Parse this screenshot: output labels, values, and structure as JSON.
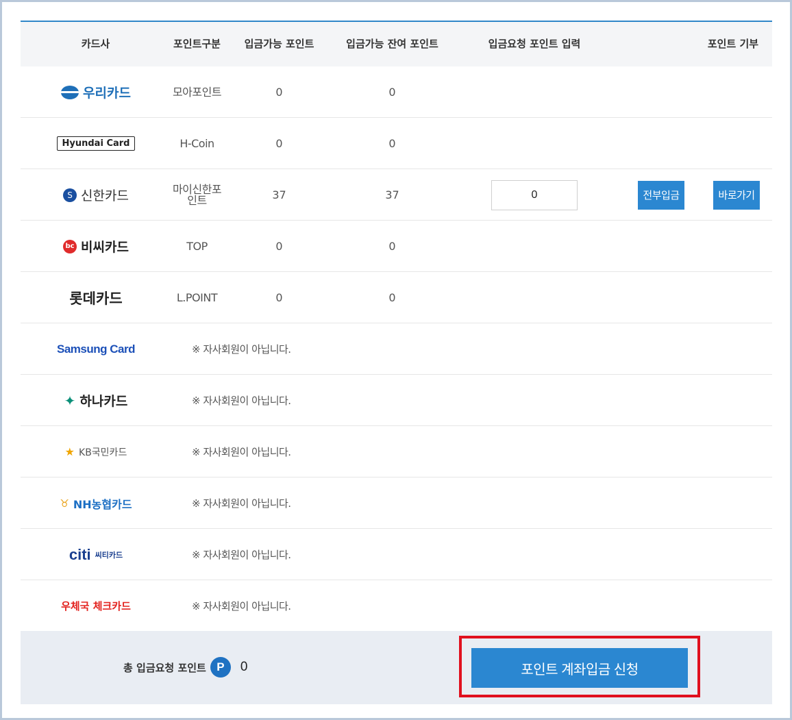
{
  "header": {
    "company": "카드사",
    "point_type": "포인트구분",
    "available": "입금가능 포인트",
    "remaining": "입금가능 잔여 포인트",
    "request_input": "입금요청 포인트 입력",
    "donate": "포인트 기부"
  },
  "rows": [
    {
      "logo": "우리카드",
      "logo_icon": "woori-logo",
      "type": "모아포인트",
      "available": "0",
      "remaining": "0"
    },
    {
      "logo": "Hyundai Card",
      "logo_icon": "hyundai-logo",
      "type": "H-Coin",
      "available": "0",
      "remaining": "0"
    },
    {
      "logo": "신한카드",
      "logo_icon": "shinhan-logo",
      "type_line1": "마이신한포",
      "type_line2": "인트",
      "available": "37",
      "remaining": "37",
      "input_value": "0",
      "all_button": "전부입금",
      "go_button": "바로가기"
    },
    {
      "logo": "비씨카드",
      "logo_icon": "bc-logo",
      "type": "TOP",
      "available": "0",
      "remaining": "0"
    },
    {
      "logo": "롯데카드",
      "logo_icon": "lotte-logo",
      "type": "L.POINT",
      "available": "0",
      "remaining": "0"
    },
    {
      "logo": "Samsung Card",
      "logo_icon": "samsung-logo",
      "note": "※ 자사회원이 아닙니다."
    },
    {
      "logo": "하나카드",
      "logo_icon": "hana-logo",
      "note": "※ 자사회원이 아닙니다."
    },
    {
      "logo": "KB국민카드",
      "logo_icon": "kb-logo",
      "note": "※ 자사회원이 아닙니다."
    },
    {
      "logo": "NH농협카드",
      "logo_icon": "nh-logo",
      "note": "※ 자사회원이 아닙니다."
    },
    {
      "logo_citi": "citi",
      "logo_citi_sub": "씨티카드",
      "logo_icon": "citi-logo",
      "note": "※ 자사회원이 아닙니다."
    },
    {
      "logo": "우체국 체크카드",
      "logo_icon": "post-logo",
      "note": "※ 자사회원이 아닙니다."
    }
  ],
  "footer": {
    "total_label": "총 입금요청 포인트",
    "p_icon": "P",
    "total_value": "0",
    "apply_button": "포인트 계좌입금 신청"
  },
  "colors": {
    "accent": "#2b87d1",
    "highlight_border": "#e0101e",
    "footer_bg": "#e9edf3"
  }
}
